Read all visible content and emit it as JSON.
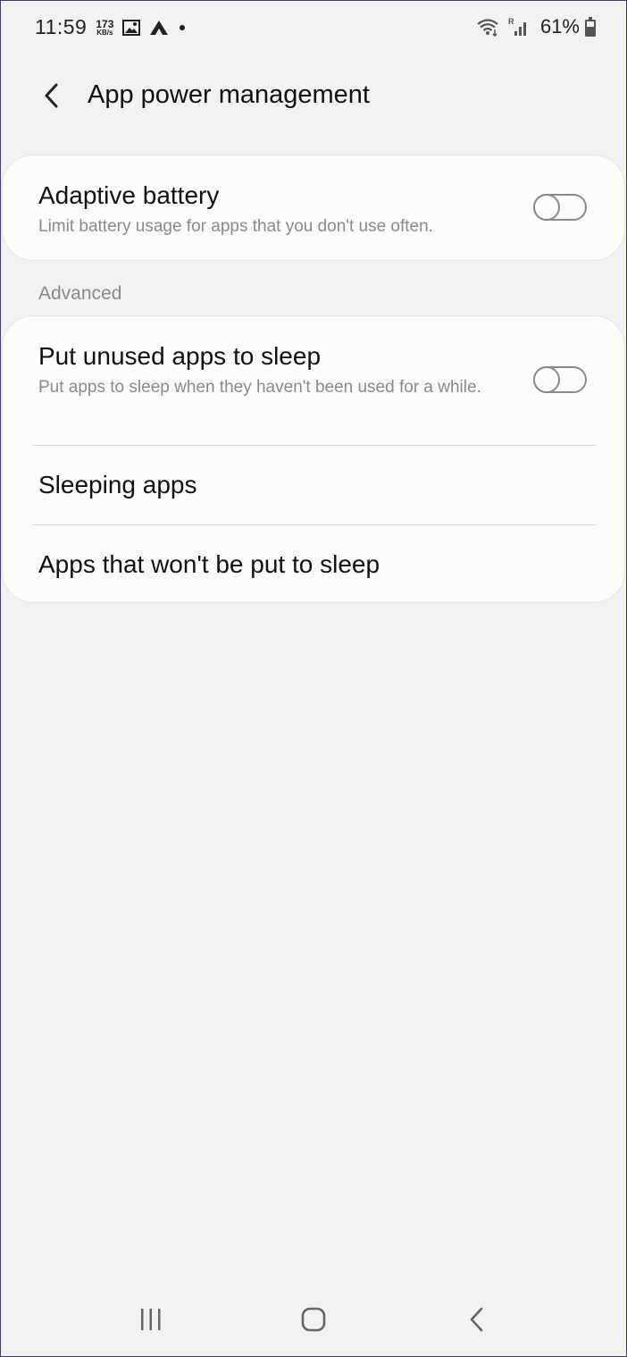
{
  "status_bar": {
    "time": "11:59",
    "net_speed_value": "173",
    "net_speed_unit": "KB/s",
    "battery_percent": "61%",
    "icons": [
      "gallery-icon",
      "app-notification-icon",
      "dot-icon",
      "wifi-icon",
      "signal-icon",
      "battery-icon"
    ]
  },
  "header": {
    "title": "App power management",
    "back_icon": "back-arrow-icon"
  },
  "adaptive_battery": {
    "title": "Adaptive battery",
    "description": "Limit battery usage for apps that you don't use often.",
    "enabled": false
  },
  "advanced": {
    "label": "Advanced",
    "items": [
      {
        "title": "Put unused apps to sleep",
        "description": "Put apps to sleep when they haven't been used for a while.",
        "enabled": false
      },
      {
        "title": "Sleeping apps"
      },
      {
        "title": "Apps that won't be put to sleep"
      }
    ]
  },
  "nav_bar": {
    "icons": [
      "recents-icon",
      "home-icon",
      "back-icon"
    ]
  },
  "colors": {
    "background": "#f2f2f2",
    "card": "#fcfcfc",
    "secondary_text": "#8a8a8a"
  }
}
